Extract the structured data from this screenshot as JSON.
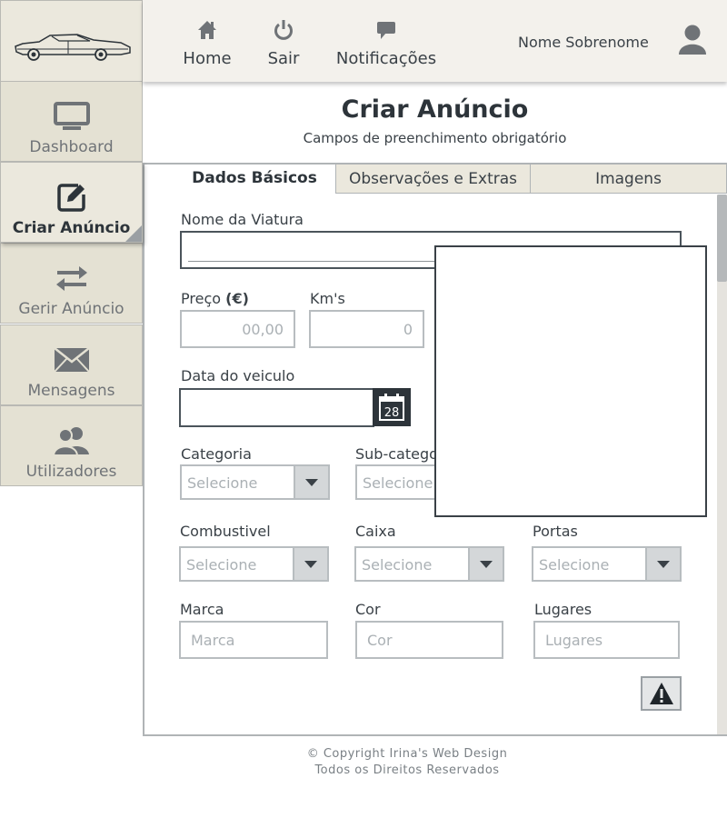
{
  "sidebar": {
    "logo_icon": "classic-car-icon",
    "items": [
      {
        "label": "Dashboard",
        "icon": "monitor-icon",
        "active": false
      },
      {
        "label": "Criar Anúncio",
        "icon": "edit-icon",
        "active": true
      },
      {
        "label": "Gerir Anúncio",
        "icon": "swap-arrows-icon",
        "active": false
      },
      {
        "label": "Mensagens",
        "icon": "envelope-icon",
        "active": false
      },
      {
        "label": "Utilizadores",
        "icon": "users-icon",
        "active": false
      }
    ]
  },
  "topbar": {
    "nav": [
      {
        "label": "Home",
        "icon": "home-icon"
      },
      {
        "label": "Sair",
        "icon": "power-icon"
      },
      {
        "label": "Notificações",
        "icon": "chat-bubble-icon"
      }
    ],
    "user_name": "Nome Sobrenome",
    "user_icon": "user-icon"
  },
  "page": {
    "title": "Criar Anúncio",
    "subtitle": "Campos de preenchimento obrigatório"
  },
  "tabs": [
    "Dados Básicos",
    "Observações e Extras",
    "Imagens"
  ],
  "form": {
    "nome_label": "Nome da Viatura",
    "nome_value": "",
    "preco_label": "Preço",
    "preco_unit": "(€)",
    "preco_placeholder": "00,00",
    "kms_label": "Km's",
    "kms_placeholder": "0",
    "data_label": "Data do veiculo",
    "data_value": "",
    "calendar_day": "28",
    "categoria_label": "Categoria",
    "categoria_value": "Selecione",
    "subcategoria_label": "Sub-catego",
    "subcategoria_value": "Selecione",
    "combustivel_label": "Combustivel",
    "combustivel_value": "Selecione",
    "caixa_label": "Caixa",
    "caixa_value": "Selecione",
    "portas_label": "Portas",
    "portas_value": "Selecione",
    "marca_label": "Marca",
    "marca_placeholder": "Marca",
    "cor_label": "Cor",
    "cor_placeholder": "Cor",
    "lugares_label": "Lugares",
    "lugares_placeholder": "Lugares"
  },
  "footer": {
    "copyright": "© Copyright Irina's Web Design",
    "rights": "Todos os Direitos Reservados"
  }
}
